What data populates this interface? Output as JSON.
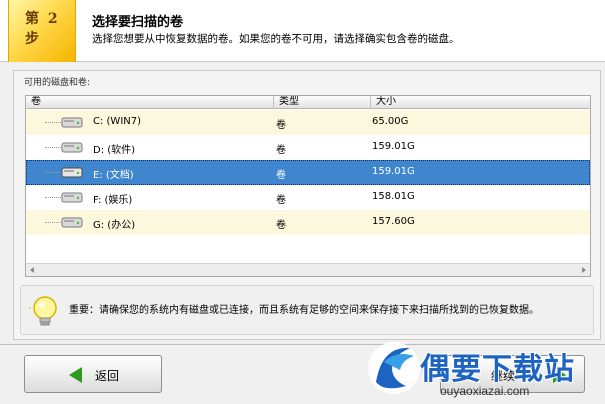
{
  "header": {
    "step": "第 2 步",
    "title": "选择要扫描的卷",
    "subtitle": "选择您想要从中恢复数据的卷。如果您的卷不可用，请选择确实包含卷的磁盘。"
  },
  "panel": {
    "label": "可用的磁盘和卷:",
    "columns": {
      "volume": "卷",
      "type": "类型",
      "size": "大小"
    },
    "rows": [
      {
        "name": "C:  (WIN7)",
        "type": "卷",
        "size": "65.00G"
      },
      {
        "name": "D:  (软件)",
        "type": "卷",
        "size": "159.01G"
      },
      {
        "name": "E:  (文档)",
        "type": "卷",
        "size": "159.01G"
      },
      {
        "name": "F:  (娱乐)",
        "type": "卷",
        "size": "158.01G"
      },
      {
        "name": "G:  (办公)",
        "type": "卷",
        "size": "157.60G"
      }
    ],
    "selected_row": "E:  (文档)"
  },
  "note": {
    "text": "重要：请确保您的系统内有磁盘或已连接，而且系统有足够的空间来保存接下来扫描所找到的已恢复数据。"
  },
  "footer": {
    "back_label": "返回",
    "next_label": "继续"
  },
  "watermark": {
    "text": "偶要下载站",
    "url": "ouyaoxiazai.com"
  },
  "colors": {
    "selection": "#3f86cf",
    "alt_row": "#fcf8dd",
    "step_badge": "#ffd84a",
    "arrow_green": "#2c9b1c",
    "watermark_blue": "#1d64c2"
  },
  "icons": [
    "disk-drive-icon",
    "lightbulb-icon",
    "back-arrow-icon",
    "next-arrow-icon",
    "watermark-logo-icon"
  ]
}
